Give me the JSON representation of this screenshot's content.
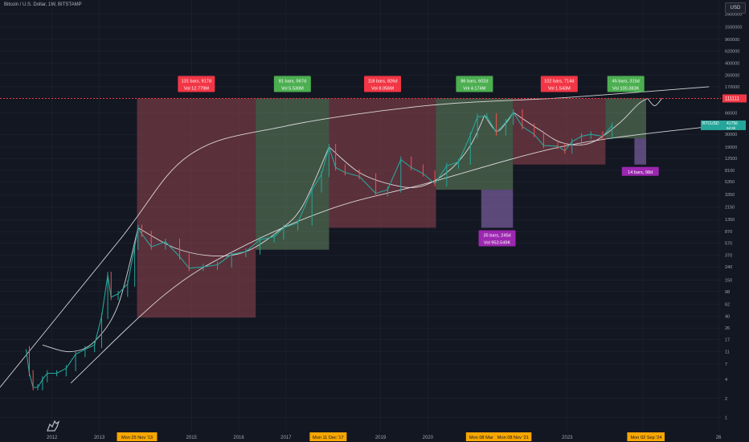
{
  "header": {
    "symbol": "Bitcoin / U.S. Dollar, 1W, BITSTAMP"
  },
  "currency_button": "USD",
  "colors": {
    "background": "#131722",
    "grid": "#1f2533",
    "axis_text": "#a0a4ae",
    "bull_box": "rgba(120,160,110,0.45)",
    "bear_box": "rgba(150,70,80,0.55)",
    "purple_box": "rgba(130,100,170,0.65)",
    "curve": "#e8e8e8",
    "price_up": "#26a69a",
    "price_down": "#ef5350",
    "dotted_line": "#f23645",
    "label_red": "#f23645",
    "label_green": "#4caf50",
    "label_purple": "#9c27b0",
    "label_orange": "#f7a600",
    "last_price_badge": "#26a69a"
  },
  "chart_data": {
    "type": "candlestick",
    "scale": "log",
    "ylim": [
      0.6,
      4000000
    ],
    "x_ticks": [
      "2012",
      "2013",
      "2015",
      "2016",
      "2017",
      "2019",
      "2020",
      "2023",
      "20",
      "26"
    ],
    "y_ticks": [
      "1",
      "2",
      "4",
      "7",
      "11",
      "17",
      "26",
      "40",
      "62",
      "98",
      "150",
      "240",
      "370",
      "570",
      "870",
      "1350",
      "2150",
      "3350",
      "5350",
      "8100",
      "12500",
      "19000",
      "30000",
      "66000",
      "170000",
      "260000",
      "400000",
      "620000",
      "960000",
      "1500000",
      "2400000"
    ],
    "price_badge": {
      "symbol": "BTCUSD",
      "price": "41756",
      "countdown": "5d 8h"
    },
    "resistance_badge": "111111",
    "date_markers": [
      {
        "label": "Mon 25 Nov '13"
      },
      {
        "label": "Mon 11 Dec '17"
      },
      {
        "label": "Mon 08 Mar"
      },
      {
        "label": "Mon 08 Nov '21"
      },
      {
        "label": "Mon"
      },
      {
        "label": "Mon 02 Sep '24"
      }
    ],
    "range_boxes": [
      {
        "kind": "bear",
        "label1": "131 bars, 917d",
        "label2": "Vol 12.779M",
        "x_from": "2013-11-25",
        "x_to": "2016-05-30",
        "y_top": 111111,
        "y_bottom": 38
      },
      {
        "kind": "bull",
        "label1": "81 bars, 567d",
        "label2": "Vol 5.530M",
        "x_from": "2016-05-30",
        "x_to": "2017-12-18",
        "y_top": 111111,
        "y_bottom": 450
      },
      {
        "kind": "bear",
        "label1": "118 bars, 826d",
        "label2": "Vol 8.056M",
        "x_from": "2017-12-18",
        "x_to": "2020-03-23",
        "y_top": 111111,
        "y_bottom": 1000
      },
      {
        "kind": "bull",
        "label1": "86 bars, 602d",
        "label2": "Vol 4.174M",
        "x_from": "2020-03-23",
        "x_to": "2021-11-08",
        "y_top": 111111,
        "y_bottom": 4000
      },
      {
        "kind": "bear",
        "label1": "102 bars, 714d",
        "label2": "Vol 1.543M",
        "x_from": "2021-11-08",
        "x_to": "2023-10-23",
        "y_top": 111111,
        "y_bottom": 10000
      },
      {
        "kind": "bull",
        "label1": "45 bars, 315d",
        "label2": "Vol 100.383K",
        "x_from": "2023-10-23",
        "x_to": "2024-09-02",
        "y_top": 111111,
        "y_bottom": 26000
      },
      {
        "kind": "purple",
        "label1": "35 bars, 245d",
        "label2": "Vol 953.549K",
        "x_from": "2021-03-08",
        "x_to": "2021-11-08",
        "y_top": 4000,
        "y_bottom": 1000
      },
      {
        "kind": "purple",
        "label1": "14 bars, 98d",
        "label2": "",
        "x_from": "2024-06-03",
        "x_to": "2024-09-02",
        "y_top": 26000,
        "y_bottom": 10000
      }
    ],
    "price_path": [
      [
        2011.55,
        12
      ],
      [
        2011.62,
        5
      ],
      [
        2011.7,
        3
      ],
      [
        2011.8,
        3
      ],
      [
        2011.9,
        4
      ],
      [
        2012.0,
        5
      ],
      [
        2012.2,
        5
      ],
      [
        2012.4,
        6
      ],
      [
        2012.6,
        10
      ],
      [
        2012.8,
        12
      ],
      [
        2013.0,
        14
      ],
      [
        2013.15,
        40
      ],
      [
        2013.28,
        180
      ],
      [
        2013.35,
        80
      ],
      [
        2013.5,
        90
      ],
      [
        2013.7,
        130
      ],
      [
        2013.85,
        500
      ],
      [
        2013.92,
        1000
      ],
      [
        2014.0,
        800
      ],
      [
        2014.2,
        500
      ],
      [
        2014.5,
        600
      ],
      [
        2014.8,
        350
      ],
      [
        2015.0,
        230
      ],
      [
        2015.3,
        240
      ],
      [
        2015.6,
        260
      ],
      [
        2015.9,
        380
      ],
      [
        2016.2,
        420
      ],
      [
        2016.5,
        650
      ],
      [
        2016.8,
        720
      ],
      [
        2017.0,
        1000
      ],
      [
        2017.3,
        1200
      ],
      [
        2017.6,
        4000
      ],
      [
        2017.8,
        7000
      ],
      [
        2017.96,
        19000
      ],
      [
        2018.1,
        9000
      ],
      [
        2018.3,
        7500
      ],
      [
        2018.6,
        6500
      ],
      [
        2018.95,
        3500
      ],
      [
        2019.2,
        4000
      ],
      [
        2019.48,
        12000
      ],
      [
        2019.7,
        9000
      ],
      [
        2019.95,
        7200
      ],
      [
        2020.2,
        5000
      ],
      [
        2020.45,
        9500
      ],
      [
        2020.7,
        11000
      ],
      [
        2020.95,
        29000
      ],
      [
        2021.1,
        57000
      ],
      [
        2021.3,
        58000
      ],
      [
        2021.5,
        32000
      ],
      [
        2021.7,
        47000
      ],
      [
        2021.86,
        67000
      ],
      [
        2022.05,
        40000
      ],
      [
        2022.3,
        30000
      ],
      [
        2022.5,
        20000
      ],
      [
        2022.8,
        19500
      ],
      [
        2022.95,
        16500
      ],
      [
        2023.1,
        23000
      ],
      [
        2023.3,
        28000
      ],
      [
        2023.5,
        30000
      ],
      [
        2023.75,
        28000
      ],
      [
        2023.95,
        41756
      ]
    ],
    "curves": [
      {
        "name": "",
        "points": [
          [
            2011.0,
            3
          ],
          [
            2013.5,
            600
          ],
          [
            2015.0,
            14000
          ],
          [
            2017.0,
            40000
          ],
          [
            2020.0,
            85000
          ],
          [
            2023.0,
            115000
          ],
          [
            2026.0,
            170000
          ]
        ]
      },
      {
        "name": "",
        "points": [
          [
            2012.5,
            3.5
          ],
          [
            2014.5,
            90
          ],
          [
            2016.0,
            450
          ],
          [
            2018.0,
            2000
          ],
          [
            2020.0,
            5000
          ],
          [
            2023.0,
            20000
          ],
          [
            2026.0,
            40000
          ]
        ]
      },
      {
        "name": "",
        "points": [
          [
            2011.9,
            14
          ],
          [
            2012.5,
            11
          ],
          [
            2013.0,
            16
          ],
          [
            2013.5,
            60
          ],
          [
            2013.92,
            1000
          ]
        ]
      },
      {
        "name": "",
        "points": [
          [
            2013.92,
            1000
          ],
          [
            2014.7,
            480
          ],
          [
            2015.5,
            360
          ],
          [
            2016.2,
            420
          ],
          [
            2016.9,
            900
          ],
          [
            2017.4,
            2200
          ],
          [
            2017.96,
            19000
          ]
        ]
      },
      {
        "name": "",
        "points": [
          [
            2017.96,
            19000
          ],
          [
            2018.6,
            7500
          ],
          [
            2019.3,
            4800
          ],
          [
            2019.9,
            4500
          ],
          [
            2020.5,
            8000
          ],
          [
            2020.95,
            20000
          ],
          [
            2021.25,
            60000
          ]
        ]
      },
      {
        "name": "",
        "points": [
          [
            2021.25,
            60000
          ],
          [
            2021.5,
            34000
          ],
          [
            2021.7,
            45000
          ],
          [
            2021.86,
            67000
          ]
        ]
      },
      {
        "name": "",
        "points": [
          [
            2021.86,
            67000
          ],
          [
            2022.4,
            36000
          ],
          [
            2022.9,
            22000
          ],
          [
            2023.5,
            22000
          ],
          [
            2024.1,
            45000
          ],
          [
            2024.5,
            90000
          ],
          [
            2024.7,
            111111
          ]
        ]
      },
      {
        "name": "",
        "points": [
          [
            2024.7,
            111111
          ],
          [
            2024.85,
            85000
          ],
          [
            2025.0,
            111111
          ]
        ]
      }
    ]
  }
}
